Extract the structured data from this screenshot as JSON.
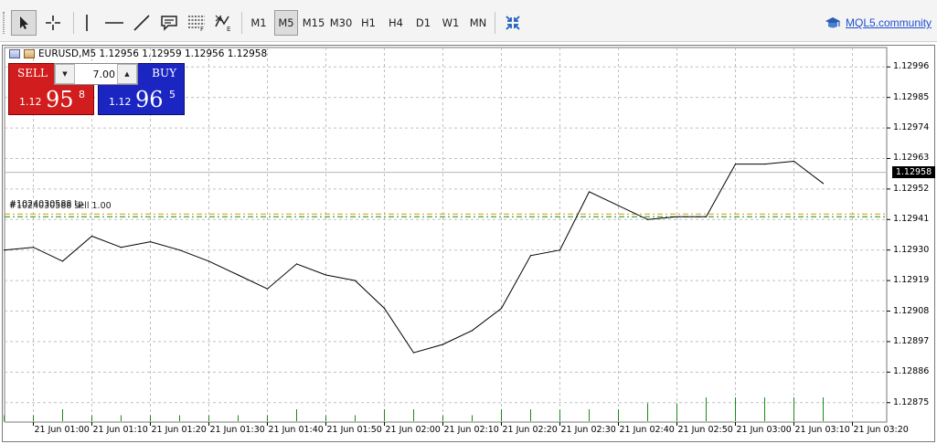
{
  "toolbar": {
    "tools": [
      {
        "name": "cursor-tool",
        "icon": "cursor-icon"
      },
      {
        "name": "crosshair-tool",
        "icon": "crosshair-icon"
      },
      {
        "name": "vertical-line-tool",
        "icon": "vertical-line-icon"
      },
      {
        "name": "horizontal-line-tool",
        "icon": "horizontal-line-icon"
      },
      {
        "name": "trendline-tool",
        "icon": "trendline-icon"
      },
      {
        "name": "text-label-tool",
        "icon": "text-label-icon"
      },
      {
        "name": "fibonacci-tool",
        "icon": "fibonacci-icon"
      },
      {
        "name": "elliott-tool",
        "icon": "elliott-icon"
      }
    ],
    "timeframes": [
      "M1",
      "M5",
      "M15",
      "M30",
      "H1",
      "H4",
      "D1",
      "W1",
      "MN"
    ],
    "active_timeframe": "M5",
    "fit_icon": "fit-chart-icon",
    "community_link": "MQL5.community",
    "community_icon": "mql5-hat-icon"
  },
  "chart": {
    "symbol_line": "EURUSD,M5  1.12956 1.12959 1.12956 1.12958",
    "symbol_icon": "chart-window-icon",
    "trade_panel": {
      "sell_label": "SELL",
      "buy_label": "BUY",
      "lot": "7.00",
      "sell_price_small": "1.12",
      "sell_price_big": "95",
      "sell_price_sup": "8",
      "buy_price_small": "1.12",
      "buy_price_big": "96",
      "buy_price_sup": "5",
      "sell_color": "#d11d1d",
      "buy_color": "#1b26c2"
    },
    "order_labels": [
      "#1024030588 tp",
      "#1024030588 sell 1.00"
    ],
    "current_price_label": "1.12958"
  },
  "chart_data": {
    "type": "line",
    "symbol": "EURUSD",
    "timeframe": "M5",
    "y_ticks": [
      "1.12996",
      "1.12985",
      "1.12974",
      "1.12963",
      "1.12952",
      "1.12941",
      "1.12930",
      "1.12919",
      "1.12908",
      "1.12897",
      "1.12886",
      "1.12875"
    ],
    "x_ticks": [
      "21 Jun 01:00",
      "21 Jun 01:10",
      "21 Jun 01:20",
      "21 Jun 01:30",
      "21 Jun 01:40",
      "21 Jun 01:50",
      "21 Jun 02:00",
      "21 Jun 02:10",
      "21 Jun 02:20",
      "21 Jun 02:30",
      "21 Jun 02:40",
      "21 Jun 02:50",
      "21 Jun 03:00",
      "21 Jun 03:10",
      "21 Jun 03:20"
    ],
    "ylim": [
      1.12868,
      1.13003
    ],
    "x": [
      "00:55",
      "01:00",
      "01:05",
      "01:10",
      "01:15",
      "01:20",
      "01:25",
      "01:30",
      "01:35",
      "01:40",
      "01:45",
      "01:50",
      "01:55",
      "02:00",
      "02:05",
      "02:10",
      "02:15",
      "02:20",
      "02:25",
      "02:30",
      "02:35",
      "02:40",
      "02:45",
      "02:50",
      "02:55",
      "03:00",
      "03:05",
      "03:10",
      "03:15"
    ],
    "close": [
      1.1293,
      1.12931,
      1.12926,
      1.12935,
      1.12931,
      1.12933,
      1.1293,
      1.12926,
      1.12921,
      1.12916,
      1.12925,
      1.12921,
      1.12919,
      1.12909,
      1.12893,
      1.12896,
      1.12901,
      1.12909,
      1.12928,
      1.1293,
      1.12951,
      1.12946,
      1.12941,
      1.12942,
      1.12942,
      1.12961,
      1.12961,
      1.12962,
      1.12954
    ],
    "current_price": 1.12958,
    "order_levels": [
      {
        "label": "#1024030588 tp",
        "price": 1.12943,
        "color": "#d0a000"
      },
      {
        "label": "#1024030588 sell 1.00",
        "price": 1.12942,
        "color": "#1a8a1a"
      }
    ],
    "volumes": [
      1,
      1,
      2,
      1,
      1,
      1,
      1,
      1,
      1,
      1,
      2,
      1,
      1,
      2,
      2,
      1,
      1,
      2,
      2,
      2,
      2,
      2,
      3,
      3,
      4,
      4,
      4,
      4,
      4
    ],
    "grid": true,
    "line_color": "#000000",
    "grid_color": "#c0c0c0",
    "volume_color": "#1a8a1a"
  }
}
